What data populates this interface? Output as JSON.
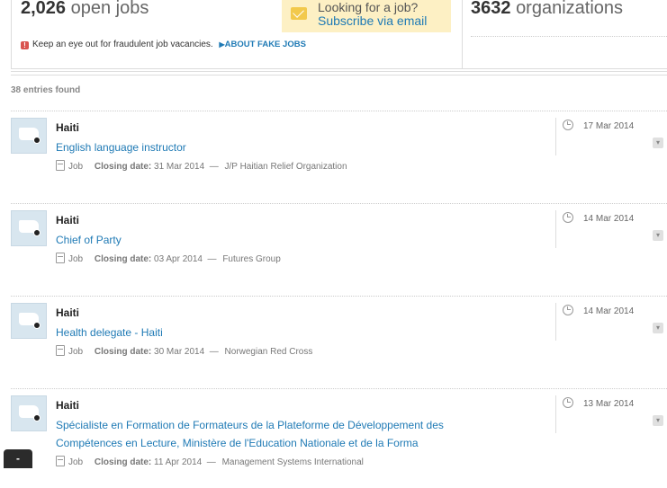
{
  "stats": {
    "open_jobs_count": "2,026",
    "open_jobs_label": "open jobs",
    "organizations_count": "3632",
    "organizations_label": "organizations"
  },
  "subscribe": {
    "line1": "Looking for a job?",
    "line2": "Subscribe via email"
  },
  "warning": {
    "text": "Keep an eye out for fraudulent job vacancies.",
    "link": "ABOUT FAKE JOBS"
  },
  "entries_found": "38 entries found",
  "jobs": [
    {
      "country": "Haiti",
      "title": "English language instructor",
      "type": "Job",
      "closing_label": "Closing date:",
      "closing_date": "31 Mar 2014",
      "dash": "—",
      "org": "J/P Haitian Relief Organization",
      "posted": "17 Mar 2014"
    },
    {
      "country": "Haiti",
      "title": "Chief of Party",
      "type": "Job",
      "closing_label": "Closing date:",
      "closing_date": "03 Apr 2014",
      "dash": "—",
      "org": "Futures Group",
      "posted": "14 Mar 2014"
    },
    {
      "country": "Haiti",
      "title": "Health delegate - Haiti",
      "type": "Job",
      "closing_label": "Closing date:",
      "closing_date": "30 Mar 2014",
      "dash": "—",
      "org": "Norwegian Red Cross",
      "posted": "14 Mar 2014"
    },
    {
      "country": "Haiti",
      "title": "Spécialiste en Formation de Formateurs de la Plateforme de Développement des Compétences en Lecture, Ministère de l'Education Nationale et de la Forma",
      "type": "Job",
      "closing_label": "Closing date:",
      "closing_date": "11 Apr 2014",
      "dash": "—",
      "org": "Management Systems International",
      "posted": "13 Mar 2014"
    }
  ],
  "bottom_tab": "-",
  "colors": {
    "link": "#1f7ab5",
    "subscribe_bg": "#fdf0c4",
    "warning_red": "#d9534f"
  }
}
